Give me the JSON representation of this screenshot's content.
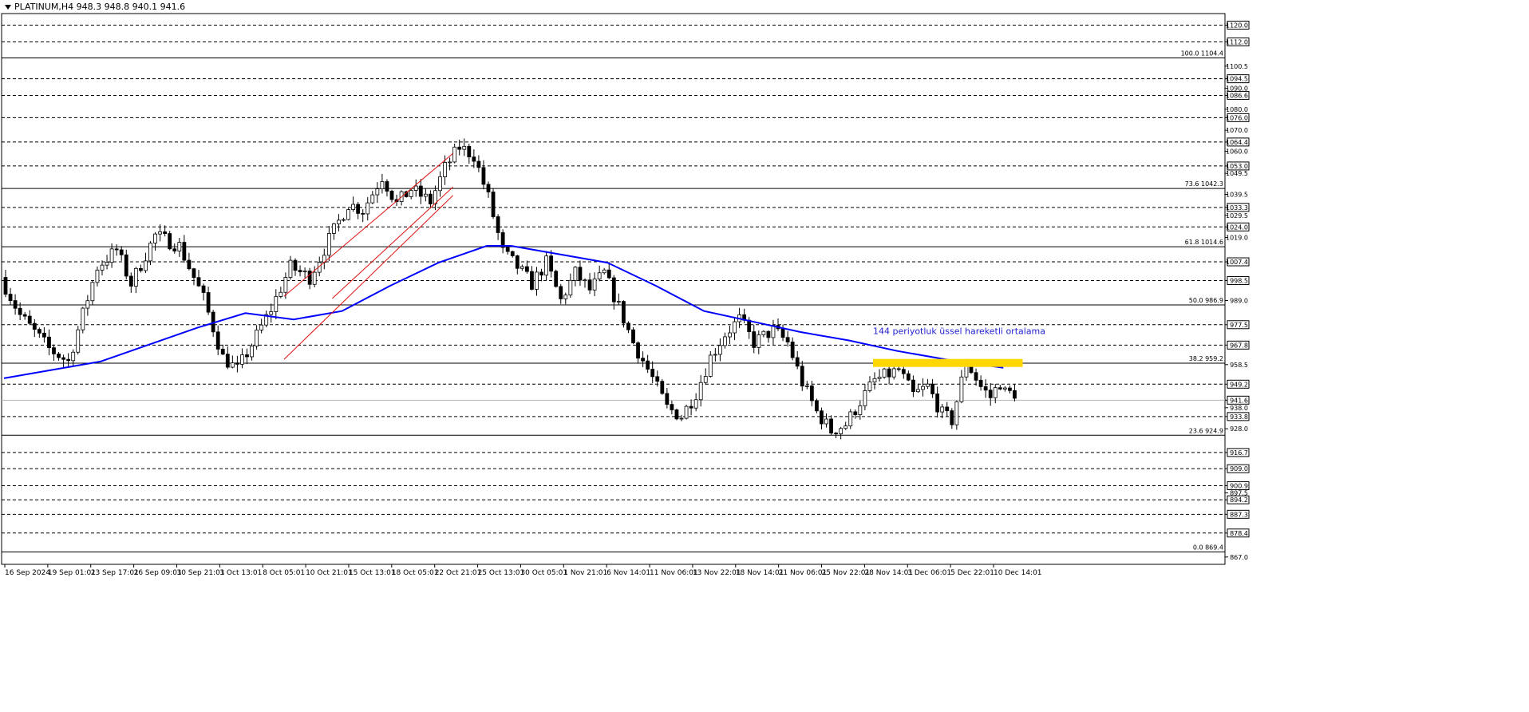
{
  "header": {
    "symbol_line": "PLATINUM,H4  948.3 948.8 940.1 941.6"
  },
  "colors": {
    "background": "#ffffff",
    "candle": "#000000",
    "ema": "#0000ff",
    "channel": "#e01010",
    "highlight": "#ffd700",
    "annotation": "#1f1fd0",
    "grid_dashed": "#000000"
  },
  "chart_data": {
    "type": "candlestick",
    "title": "",
    "symbol": "PLATINUM",
    "timeframe": "H4",
    "ylim": [
      863.5,
      1125.5
    ],
    "x_tick_labels": [
      "16 Sep 2024",
      "19 Sep 01:01",
      "23 Sep 17:01",
      "26 Sep 09:01",
      "30 Sep 21:01",
      "3 Oct 13:01",
      "8 Oct 05:01",
      "10 Oct 21:01",
      "15 Oct 13:01",
      "18 Oct 05:01",
      "22 Oct 21:01",
      "25 Oct 13:01",
      "30 Oct 05:01",
      "1 Nov 21:01",
      "6 Nov 14:01",
      "11 Nov 06:01",
      "13 Nov 22:01",
      "18 Nov 14:01",
      "21 Nov 06:01",
      "25 Nov 22:01",
      "28 Nov 14:01",
      "3 Dec 06:01",
      "5 Dec 22:01",
      "10 Dec 14:01"
    ],
    "y_tick_labels": [
      1120.0,
      1112.0,
      1100.5,
      1094.5,
      1090.0,
      1086.6,
      1080.0,
      1076.0,
      1070.0,
      1064.4,
      1060.0,
      1053.0,
      1049.5,
      1039.5,
      1033.3,
      1029.5,
      1024.0,
      1019.0,
      1007.4,
      998.5,
      989.0,
      977.5,
      967.8,
      958.5,
      949.2,
      941.6,
      938.0,
      933.8,
      928.0,
      916.7,
      909.0,
      900.9,
      897.5,
      894.2,
      887.3,
      878.4,
      867.0
    ],
    "boxed_levels": [
      1120.0,
      1112.0,
      1094.5,
      1086.6,
      1076.0,
      1064.4,
      1053.0,
      1033.3,
      1024.0,
      1007.4,
      998.5,
      977.5,
      967.8,
      949.2,
      941.6,
      933.8,
      916.7,
      909.0,
      900.9,
      894.2,
      887.3,
      878.4
    ],
    "dashed_levels": [
      1120.0,
      1112.0,
      1094.5,
      1086.6,
      1076.0,
      1064.4,
      1053.0,
      1033.3,
      1024.0,
      1007.4,
      998.5,
      977.5,
      967.8,
      949.2,
      933.8,
      916.7,
      909.0,
      900.9,
      894.2,
      887.3,
      878.4
    ],
    "current_price": 941.6,
    "fibonacci": [
      {
        "label": "100.0 1104.4",
        "value": 1104.4
      },
      {
        "label": "73.6 1042.3",
        "value": 1042.3
      },
      {
        "label": "61.8 1014.6",
        "value": 1014.6
      },
      {
        "label": "50.0 986.9",
        "value": 986.9
      },
      {
        "label": "38.2 959.2",
        "value": 959.2
      },
      {
        "label": "23.6 924.9",
        "value": 924.9
      },
      {
        "label": "0.0 869.4",
        "value": 869.4
      }
    ],
    "anchors": [
      [
        0,
        1000
      ],
      [
        4,
        982
      ],
      [
        10,
        966
      ],
      [
        14,
        960
      ],
      [
        20,
        1005
      ],
      [
        24,
        1013
      ],
      [
        27,
        997
      ],
      [
        32,
        1020
      ],
      [
        37,
        1015
      ],
      [
        42,
        990
      ],
      [
        46,
        962
      ],
      [
        49,
        956
      ],
      [
        52,
        968
      ],
      [
        56,
        985
      ],
      [
        60,
        1005
      ],
      [
        64,
        1000
      ],
      [
        68,
        1018
      ],
      [
        72,
        1035
      ],
      [
        75,
        1032
      ],
      [
        79,
        1048
      ],
      [
        82,
        1035
      ],
      [
        85,
        1042
      ],
      [
        89,
        1036
      ],
      [
        92,
        1052
      ],
      [
        95,
        1062
      ],
      [
        98,
        1058
      ],
      [
        101,
        1038
      ],
      [
        104,
        1012
      ],
      [
        107,
        1005
      ],
      [
        110,
        997
      ],
      [
        113,
        1007
      ],
      [
        116,
        989
      ],
      [
        119,
        1002
      ],
      [
        122,
        994
      ],
      [
        125,
        1002
      ],
      [
        128,
        986
      ],
      [
        131,
        969
      ],
      [
        135,
        952
      ],
      [
        138,
        938
      ],
      [
        141,
        934
      ],
      [
        144,
        945
      ],
      [
        147,
        962
      ],
      [
        150,
        973
      ],
      [
        153,
        980
      ],
      [
        156,
        969
      ],
      [
        160,
        975
      ],
      [
        163,
        969
      ],
      [
        166,
        950
      ],
      [
        169,
        936
      ],
      [
        172,
        927
      ],
      [
        175,
        930
      ],
      [
        178,
        941
      ],
      [
        181,
        951
      ],
      [
        184,
        954
      ],
      [
        186,
        956
      ],
      [
        189,
        944
      ],
      [
        192,
        948
      ],
      [
        195,
        935
      ],
      [
        197,
        932
      ],
      [
        200,
        960
      ],
      [
        203,
        948
      ],
      [
        205,
        943
      ],
      [
        207,
        950
      ],
      [
        208,
        945
      ]
    ],
    "ema_period": 144,
    "ema_label": "144 periyotluk üssel hareketli ortalama",
    "ema_points": [
      [
        0,
        952
      ],
      [
        20,
        960
      ],
      [
        40,
        976
      ],
      [
        50,
        983
      ],
      [
        60,
        980
      ],
      [
        70,
        984
      ],
      [
        80,
        996
      ],
      [
        90,
        1007
      ],
      [
        100,
        1015
      ],
      [
        105,
        1015
      ],
      [
        115,
        1011
      ],
      [
        125,
        1007
      ],
      [
        135,
        996
      ],
      [
        145,
        984
      ],
      [
        155,
        979
      ],
      [
        165,
        974
      ],
      [
        175,
        970
      ],
      [
        185,
        965
      ],
      [
        195,
        961
      ],
      [
        207,
        957
      ]
    ],
    "channel_lines": [
      [
        [
          58,
          991
        ],
        [
          93,
          1059
        ]
      ],
      [
        [
          58,
          961
        ],
        [
          93,
          1039
        ]
      ],
      [
        [
          68,
          990
        ],
        [
          93,
          1043
        ]
      ]
    ],
    "highlight_box": {
      "x": [
        180,
        211
      ],
      "y": [
        957.4,
        961.2
      ]
    }
  }
}
